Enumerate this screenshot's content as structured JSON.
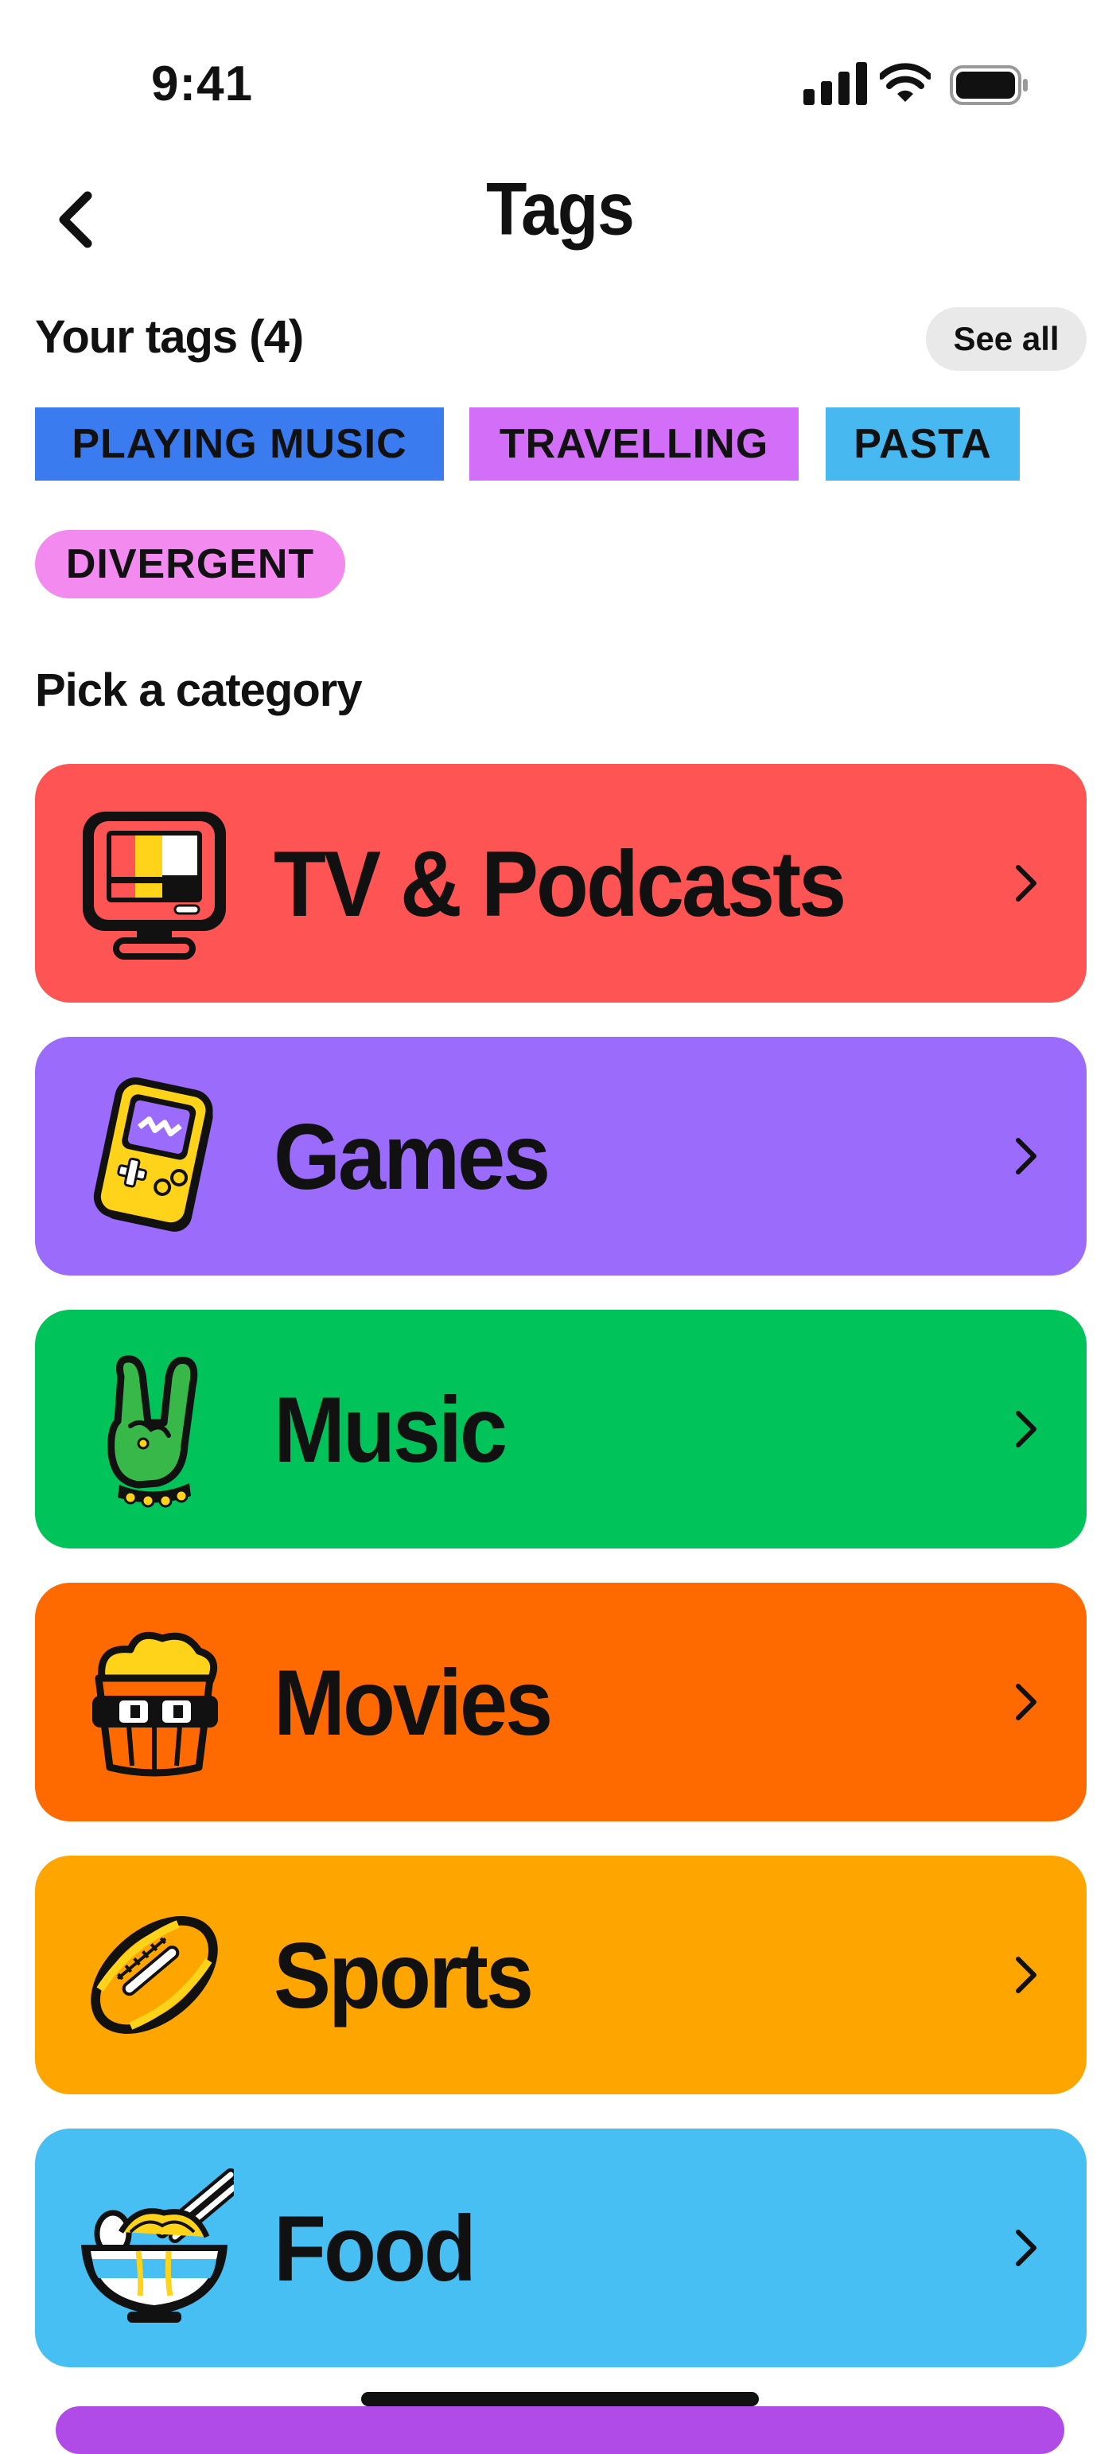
{
  "status_bar": {
    "time": "9:41"
  },
  "header": {
    "title": "Tags"
  },
  "your_tags": {
    "title": "Your tags (4)",
    "see_all_label": "See all",
    "tags": [
      {
        "label": "PLAYING MUSIC",
        "color": "#3a7cf0"
      },
      {
        "label": "TRAVELLING",
        "color": "#d26ef7"
      },
      {
        "label": "PASTA",
        "color": "#47b8f0"
      },
      {
        "label": "DIVERGENT",
        "color": "#f28af0"
      }
    ]
  },
  "categories_section": {
    "title": "Pick a category",
    "items": [
      {
        "label": "TV & Podcasts",
        "color": "#ff5454",
        "icon": "tv-icon"
      },
      {
        "label": "Games",
        "color": "#9b6bfc",
        "icon": "game-console-icon"
      },
      {
        "label": "Music",
        "color": "#00c35a",
        "icon": "rock-hand-icon"
      },
      {
        "label": "Movies",
        "color": "#ff6a00",
        "icon": "popcorn-icon"
      },
      {
        "label": "Sports",
        "color": "#ffa500",
        "icon": "football-icon"
      },
      {
        "label": "Food",
        "color": "#47bff2",
        "icon": "noodle-bowl-icon"
      }
    ]
  }
}
